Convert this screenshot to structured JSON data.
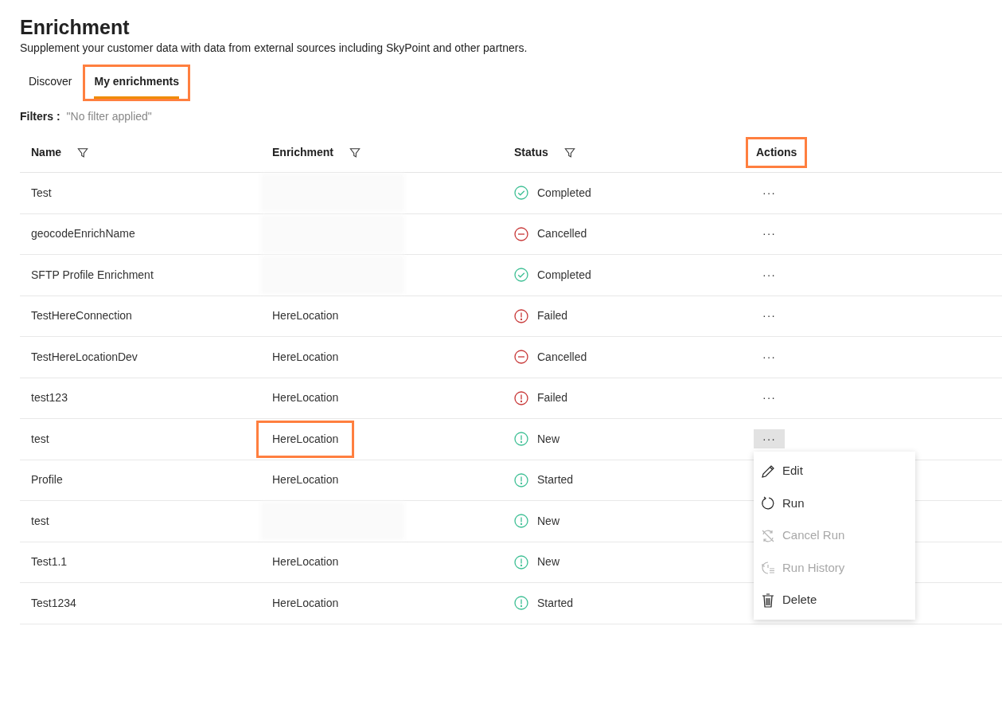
{
  "page": {
    "title": "Enrichment",
    "subtitle": "Supplement your customer data with data from external sources including SkyPoint and other partners."
  },
  "tabs": [
    {
      "label": "Discover",
      "selected": false,
      "highlighted": false
    },
    {
      "label": "My enrichments",
      "selected": true,
      "highlighted": true
    }
  ],
  "filters": {
    "label": "Filters :",
    "value": "\"No filter applied\""
  },
  "table": {
    "columns": [
      {
        "label": "Name",
        "filter": true,
        "highlighted": false
      },
      {
        "label": "Enrichment",
        "filter": true,
        "highlighted": false
      },
      {
        "label": "Status",
        "filter": true,
        "highlighted": false
      },
      {
        "label": "Actions",
        "filter": false,
        "highlighted": true
      }
    ],
    "actions_label": "···",
    "rows": [
      {
        "name": "Test",
        "enrichment": {
          "redacted": true
        },
        "status": {
          "kind": "completed",
          "text": "Completed"
        },
        "menu_open": false
      },
      {
        "name": "geocodeEnrichName",
        "enrichment": {
          "redacted": true
        },
        "status": {
          "kind": "cancelled",
          "text": "Cancelled"
        },
        "menu_open": false
      },
      {
        "name": "SFTP Profile Enrichment",
        "enrichment": {
          "redacted": true
        },
        "status": {
          "kind": "completed",
          "text": "Completed"
        },
        "menu_open": false
      },
      {
        "name": "TestHereConnection",
        "enrichment": {
          "redacted": false,
          "text": "HereLocation",
          "highlighted": false
        },
        "status": {
          "kind": "failed",
          "text": "Failed"
        },
        "menu_open": false
      },
      {
        "name": "TestHereLocationDev",
        "enrichment": {
          "redacted": false,
          "text": "HereLocation",
          "highlighted": false
        },
        "status": {
          "kind": "cancelled",
          "text": "Cancelled"
        },
        "menu_open": false
      },
      {
        "name": "test123",
        "enrichment": {
          "redacted": false,
          "text": "HereLocation",
          "highlighted": false
        },
        "status": {
          "kind": "failed",
          "text": "Failed"
        },
        "menu_open": false
      },
      {
        "name": "test",
        "enrichment": {
          "redacted": false,
          "text": "HereLocation",
          "highlighted": true
        },
        "status": {
          "kind": "new",
          "text": "New"
        },
        "menu_open": true
      },
      {
        "name": "Profile",
        "enrichment": {
          "redacted": false,
          "text": "HereLocation",
          "highlighted": false
        },
        "status": {
          "kind": "started",
          "text": "Started"
        }
      },
      {
        "name": "test",
        "enrichment": {
          "redacted": true
        },
        "status": {
          "kind": "new",
          "text": "New"
        }
      },
      {
        "name": "Test1.1",
        "enrichment": {
          "redacted": false,
          "text": "HereLocation",
          "highlighted": false
        },
        "status": {
          "kind": "new",
          "text": "New"
        }
      },
      {
        "name": "Test1234",
        "enrichment": {
          "redacted": false,
          "text": "HereLocation",
          "highlighted": false
        },
        "status": {
          "kind": "started",
          "text": "Started"
        }
      }
    ]
  },
  "menu": {
    "items": [
      {
        "kind": "edit",
        "label": "Edit",
        "disabled": false
      },
      {
        "kind": "run",
        "label": "Run",
        "disabled": false
      },
      {
        "kind": "cancel",
        "label": "Cancel Run",
        "disabled": true
      },
      {
        "kind": "history",
        "label": "Run History",
        "disabled": true
      },
      {
        "kind": "delete",
        "label": "Delete",
        "disabled": false
      }
    ]
  }
}
